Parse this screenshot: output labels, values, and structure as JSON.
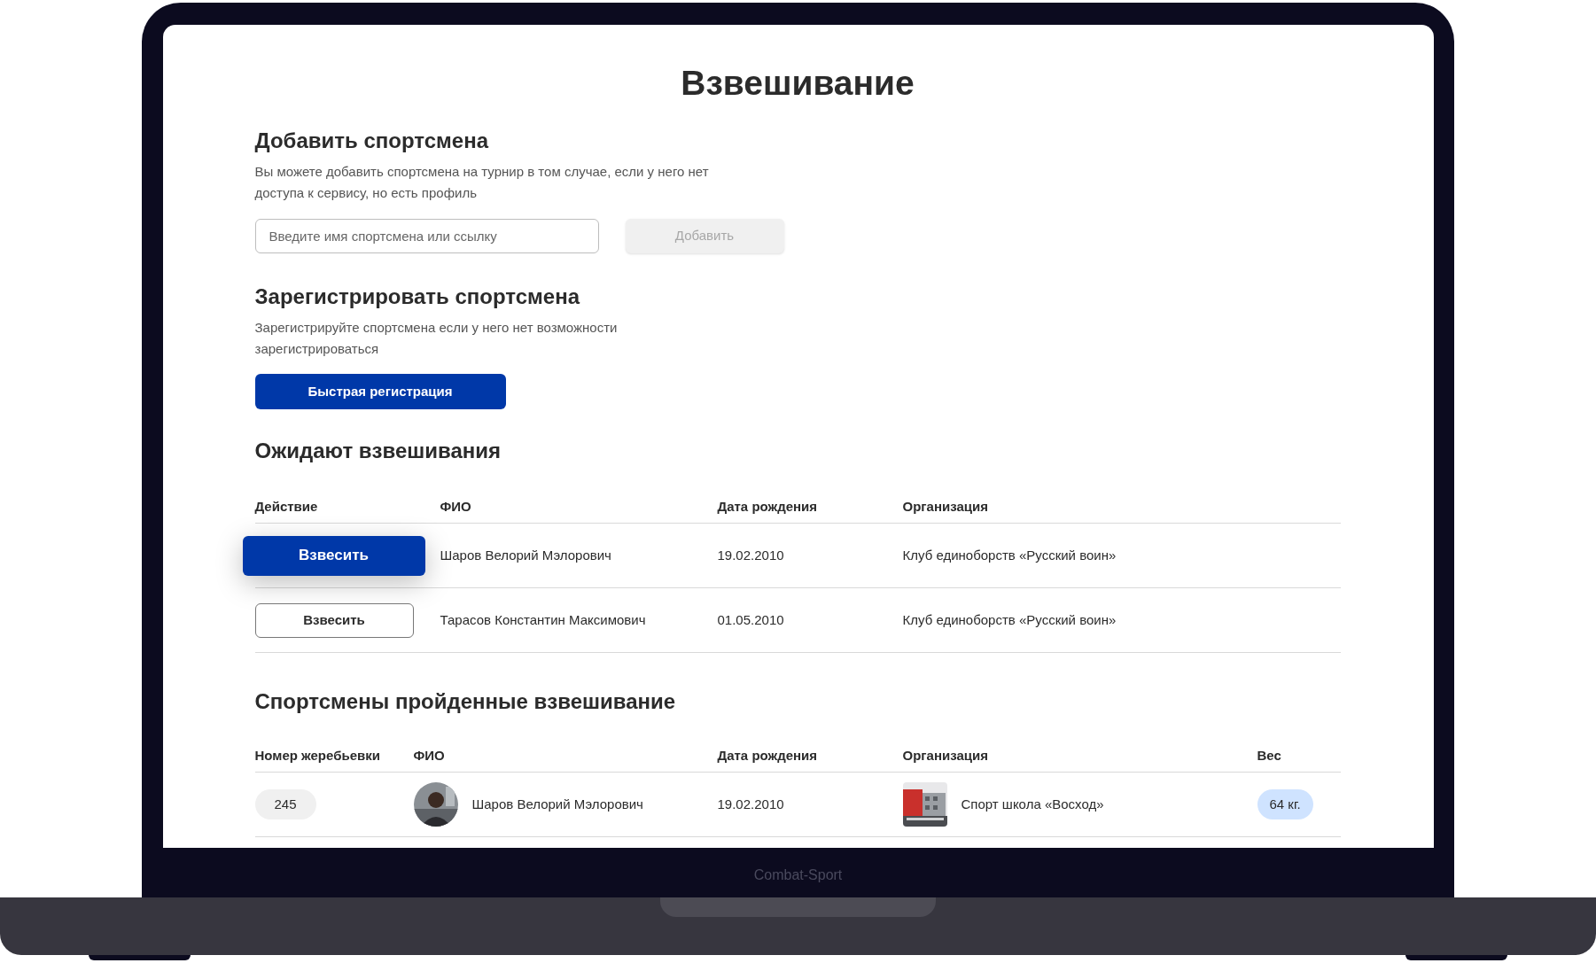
{
  "device_label": "Combat-Sport",
  "page": {
    "title": "Взвешивание"
  },
  "add_section": {
    "title": "Добавить спортсмена",
    "description": "Вы можете добавить спортсмена на турнир в том случае, если у него нет доступа к сервису, но есть профиль",
    "field": {
      "placeholder": "Введите имя спортсмена или ссылку"
    },
    "button": {
      "label": "Добавить",
      "disabled": true
    }
  },
  "register_section": {
    "title": "Зарегистрировать спортсмена",
    "description": "Зарегистрируйте спортсмена если у него нет возможности зарегистрироваться",
    "button": {
      "label": "Быстрая регистрация"
    }
  },
  "waiting": {
    "title": "Ожидают взвешивания",
    "columns": [
      "Действие",
      "ФИО",
      "Дата рождения",
      "Организация"
    ],
    "rows": [
      {
        "action": {
          "label": "Взвесить",
          "highlighted": true
        },
        "name": "Шаров Велорий Мэлорович",
        "birth_date": "19.02.2010",
        "organization": "Клуб единоборств «Русский воин»"
      },
      {
        "action": {
          "label": "Взвесить",
          "highlighted": false
        },
        "name": "Тарасов Константин Максимович",
        "birth_date": "01.05.2010",
        "organization": "Клуб единоборств «Русский воин»"
      }
    ]
  },
  "weighed": {
    "title": "Спортсмены пройденные взвешивание",
    "columns": [
      "Номер жеребьевки",
      "ФИО",
      "Дата рождения",
      "Организация",
      "Вес"
    ],
    "rows": [
      {
        "draw_number": "245",
        "name": "Шаров Велорий Мэлорович",
        "birth_date": "19.02.2010",
        "organization": "Спорт школа «Восход»",
        "weight": "64 кг."
      }
    ]
  }
}
